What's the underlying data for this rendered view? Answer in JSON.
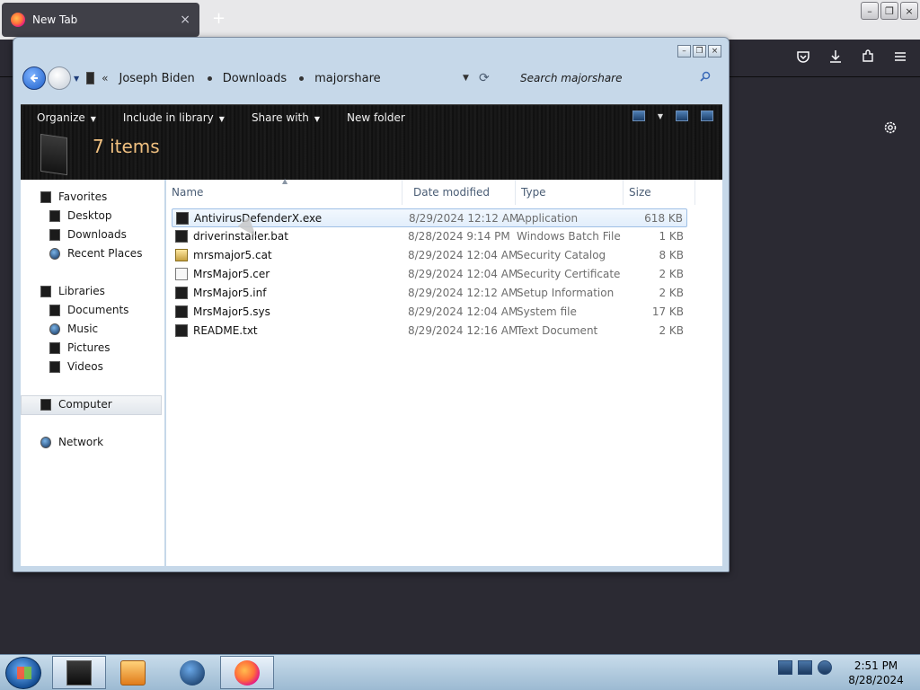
{
  "browser": {
    "tab_title": "New Tab",
    "tab_close": "×",
    "new_tab": "+",
    "win_min": "–",
    "win_restore": "❐",
    "win_close": "×"
  },
  "explorer": {
    "breadcrumb": [
      "Joseph Biden",
      "Downloads",
      "majorshare"
    ],
    "search_placeholder": "Search majorshare",
    "toolbar": {
      "organize": "Organize",
      "include_in_library": "Include in library",
      "share_with": "Share with",
      "new_folder": "New folder"
    },
    "item_count": "7 items",
    "nav": {
      "favorites": "Favorites",
      "desktop": "Desktop",
      "downloads": "Downloads",
      "recent_places": "Recent Places",
      "libraries": "Libraries",
      "documents": "Documents",
      "music": "Music",
      "pictures": "Pictures",
      "videos": "Videos",
      "computer": "Computer",
      "network": "Network"
    },
    "columns": {
      "name": "Name",
      "date": "Date modified",
      "type": "Type",
      "size": "Size"
    },
    "files": [
      {
        "name": "AntivirusDefenderX.exe",
        "date": "8/29/2024 12:12 AM",
        "type": "Application",
        "size": "618 KB",
        "icon": "exe-icon"
      },
      {
        "name": "driverinstaller.bat",
        "date": "8/28/2024 9:14 PM",
        "type": "Windows Batch File",
        "size": "1 KB",
        "icon": "bat-icon"
      },
      {
        "name": "mrsmajor5.cat",
        "date": "8/29/2024 12:04 AM",
        "type": "Security Catalog",
        "size": "8 KB",
        "icon": "catalog-icon"
      },
      {
        "name": "MrsMajor5.cer",
        "date": "8/29/2024 12:04 AM",
        "type": "Security Certificate",
        "size": "2 KB",
        "icon": "certificate-icon"
      },
      {
        "name": "MrsMajor5.inf",
        "date": "8/29/2024 12:12 AM",
        "type": "Setup Information",
        "size": "2 KB",
        "icon": "inf-icon"
      },
      {
        "name": "MrsMajor5.sys",
        "date": "8/29/2024 12:04 AM",
        "type": "System file",
        "size": "17 KB",
        "icon": "sys-icon"
      },
      {
        "name": "README.txt",
        "date": "8/29/2024 12:16 AM",
        "type": "Text Document",
        "size": "2 KB",
        "icon": "txt-icon"
      }
    ]
  },
  "taskbar": {
    "time": "2:51 PM",
    "date": "8/28/2024"
  },
  "colors": {
    "accent": "#1c5fc9",
    "item_count": "#f0c080",
    "dark_bg": "#2b2a33"
  }
}
